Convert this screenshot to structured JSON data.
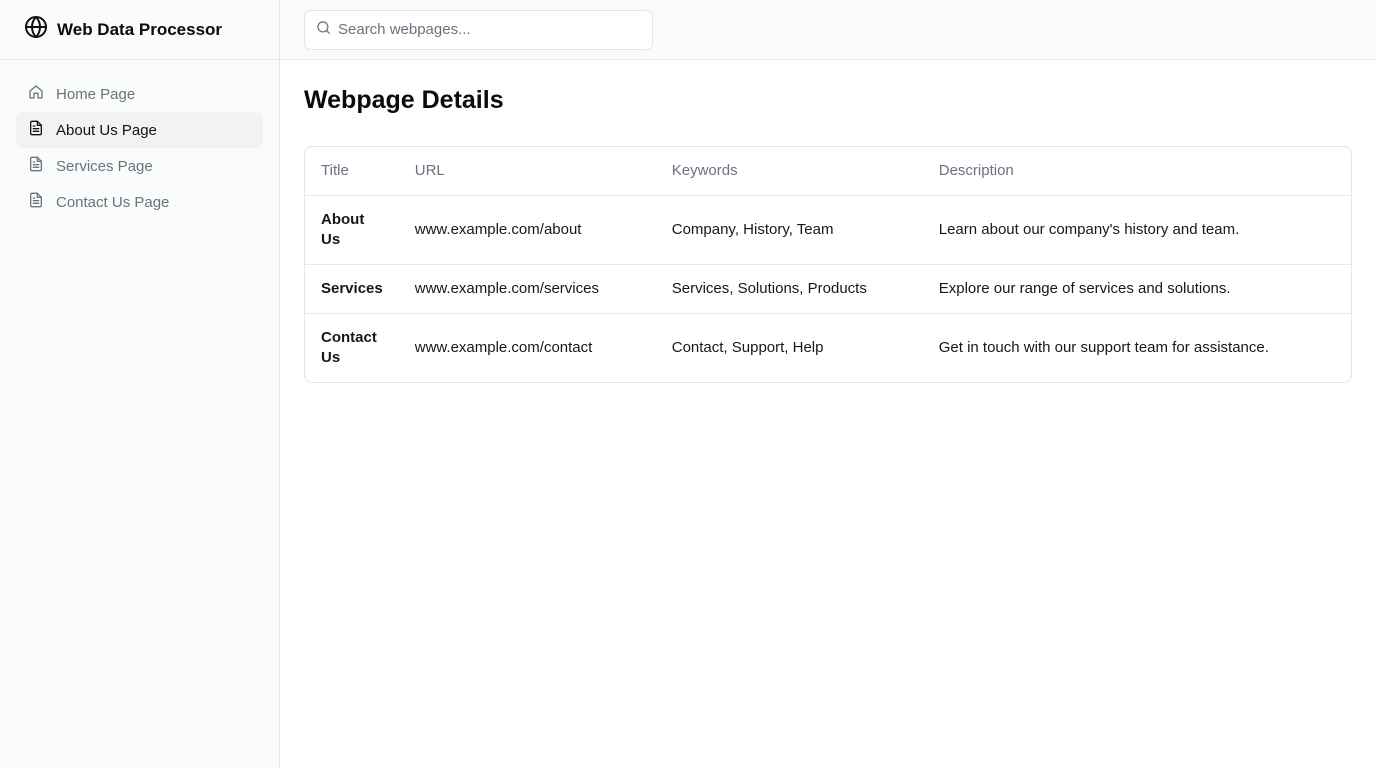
{
  "app": {
    "title": "Web Data Processor",
    "logo_icon": "globe-icon"
  },
  "sidebar": {
    "items": [
      {
        "label": "Home Page",
        "icon": "home-icon",
        "active": false
      },
      {
        "label": "About Us Page",
        "icon": "document-icon",
        "active": true
      },
      {
        "label": "Services Page",
        "icon": "document-icon",
        "active": false
      },
      {
        "label": "Contact Us Page",
        "icon": "document-icon",
        "active": false
      }
    ]
  },
  "search": {
    "placeholder": "Search webpages...",
    "value": ""
  },
  "main": {
    "title": "Webpage Details",
    "table": {
      "headers": [
        "Title",
        "URL",
        "Keywords",
        "Description"
      ],
      "rows": [
        {
          "title": "About Us",
          "url": "www.example.com/about",
          "keywords": "Company, History, Team",
          "description": "Learn about our company's history and team."
        },
        {
          "title": "Services",
          "url": "www.example.com/services",
          "keywords": "Services, Solutions, Products",
          "description": "Explore our range of services and solutions."
        },
        {
          "title": "Contact Us",
          "url": "www.example.com/contact",
          "keywords": "Contact, Support, Help",
          "description": "Get in touch with our support team for assistance."
        }
      ]
    }
  },
  "colors": {
    "active_bg": "#f0f2f4",
    "muted_text": "#6b7280",
    "border": "#e6e8eb"
  }
}
